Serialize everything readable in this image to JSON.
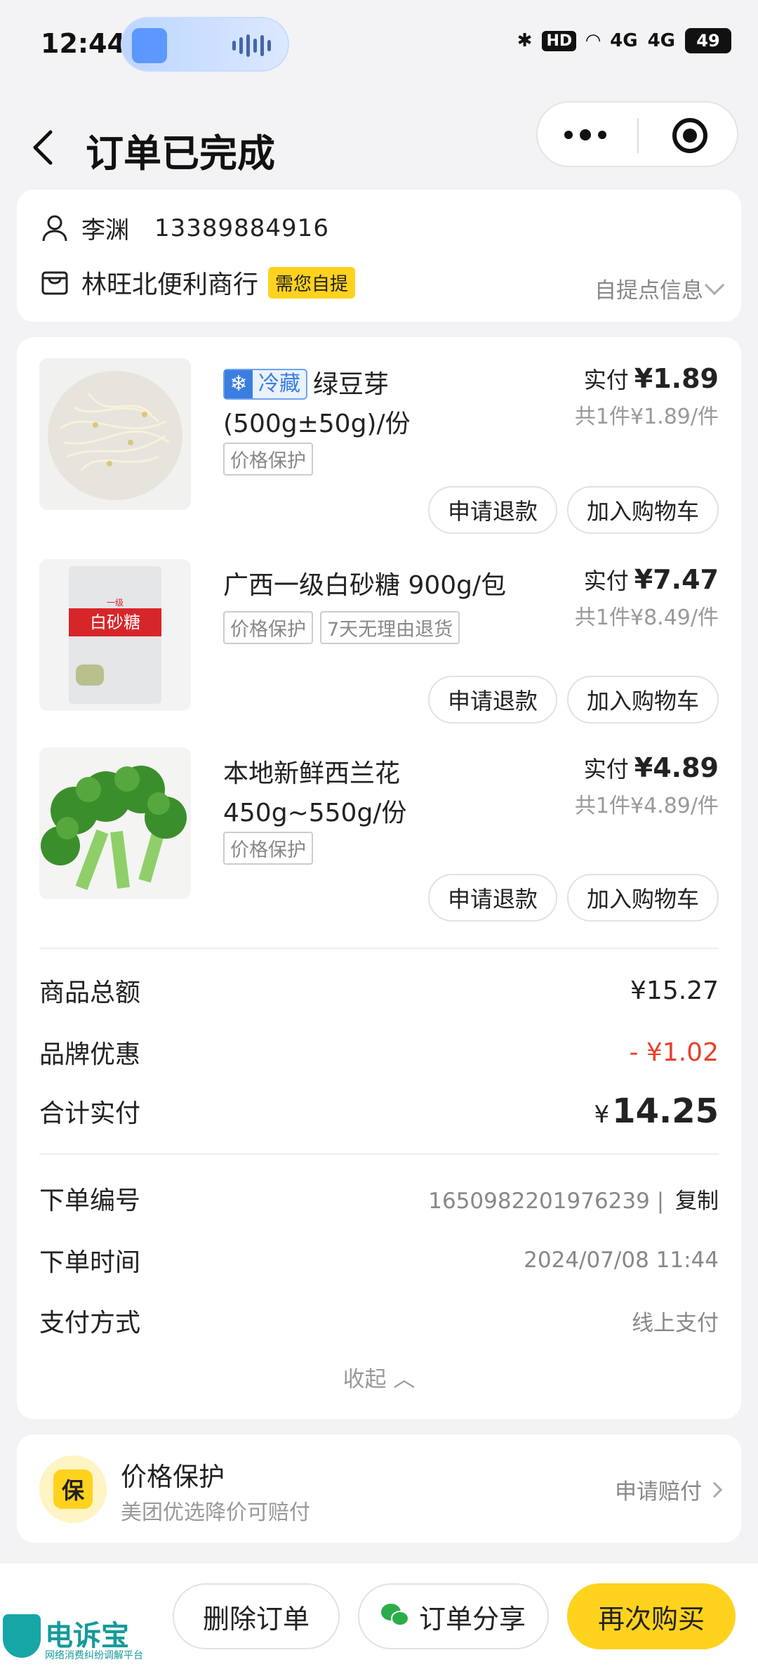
{
  "status_bar": {
    "time": "12:44",
    "hd_label": "HD",
    "net1": "4G",
    "net2": "4G",
    "battery": "49"
  },
  "nav": {
    "title": "订单已完成"
  },
  "pickup": {
    "user_name": "李渊",
    "phone": "13389884916",
    "store_name": "林旺北便利商行",
    "self_pickup_tag": "需您自提",
    "info_link": "自提点信息"
  },
  "products": [
    {
      "badge": "冷藏",
      "name": "绿豆芽 (500g±50g)/份",
      "tags": [
        "价格保护"
      ],
      "paid_label": "实付",
      "paid": "¥1.89",
      "each": "共1件¥1.89/件",
      "refund_label": "申请退款",
      "cart_label": "加入购物车"
    },
    {
      "name": "广西一级白砂糖 900g/包",
      "tags": [
        "价格保护",
        "7天无理由退货"
      ],
      "paid_label": "实付",
      "paid": "¥7.47",
      "each": "共1件¥8.49/件",
      "refund_label": "申请退款",
      "cart_label": "加入购物车",
      "package_text": "白砂糖",
      "package_grade": "一级"
    },
    {
      "name": "本地新鲜西兰花 450g~550g/份",
      "tags": [
        "价格保护"
      ],
      "paid_label": "实付",
      "paid": "¥4.89",
      "each": "共1件¥4.89/件",
      "refund_label": "申请退款",
      "cart_label": "加入购物车"
    }
  ],
  "summary": {
    "goods_total_label": "商品总额",
    "goods_total": "¥15.27",
    "discount_label": "品牌优惠",
    "discount": "- ¥1.02",
    "paid_total_label": "合计实付",
    "paid_total_currency": "¥",
    "paid_total": "14.25"
  },
  "order_info": {
    "order_no_label": "下单编号",
    "order_no": "1650982201976239",
    "copy_label": "复制",
    "order_time_label": "下单时间",
    "order_time": "2024/07/08 11:44",
    "pay_method_label": "支付方式",
    "pay_method": "线上支付",
    "collapse_label": "收起"
  },
  "price_protection": {
    "icon_text": "保",
    "title": "价格保护",
    "subtitle": "美团优选降价可赔付",
    "link": "申请赔付"
  },
  "bottom_bar": {
    "delete_label": "删除订单",
    "share_label": "订单分享",
    "rebuy_label": "再次购买"
  },
  "watermark": {
    "title": "电诉宝",
    "subtitle": "网络消费纠纷调解平台"
  },
  "colors": {
    "accent_yellow": "#ffd21e",
    "discount_red": "#e8412c",
    "cold_blue": "#3b7de0"
  }
}
